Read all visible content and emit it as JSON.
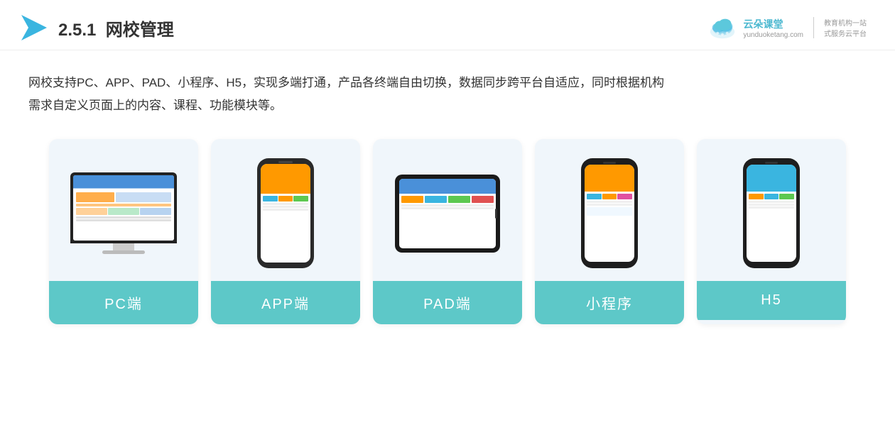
{
  "header": {
    "section_number": "2.5.1",
    "title": "网校管理",
    "brand": {
      "name": "云朵课堂",
      "url": "yunduoketang.com",
      "tagline1": "教育机构一站",
      "tagline2": "式服务云平台"
    }
  },
  "description": {
    "line1": "网校支持PC、APP、PAD、小程序、H5，实现多端打通，产品各终端自由切换，数据同步跨平台自适应，同时根据机构",
    "line2": "需求自定义页面上的内容、课程、功能模块等。"
  },
  "devices": [
    {
      "id": "pc",
      "label": "PC端",
      "type": "pc"
    },
    {
      "id": "app",
      "label": "APP端",
      "type": "phone"
    },
    {
      "id": "pad",
      "label": "PAD端",
      "type": "pad"
    },
    {
      "id": "miniapp",
      "label": "小程序",
      "type": "phone"
    },
    {
      "id": "h5",
      "label": "H5",
      "type": "phone"
    }
  ]
}
